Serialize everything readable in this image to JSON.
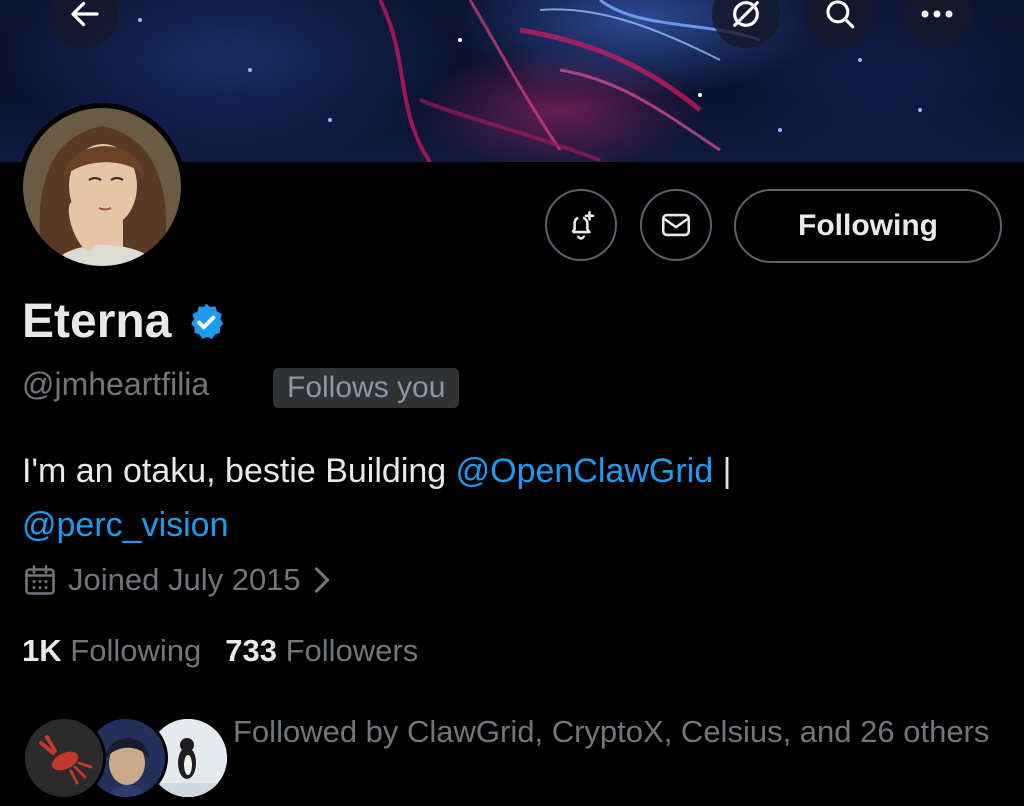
{
  "header": {
    "back_icon": "arrow-left-icon",
    "icons": [
      "eye-off-icon",
      "search-icon",
      "more-icon"
    ]
  },
  "profile": {
    "name": "Eterna",
    "verified": true,
    "handle": "@jmheartfilia",
    "follows_you": "Follows you",
    "bio_text": "I'm an otaku, bestie Building ",
    "bio_mention_1": "@OpenClawGrid",
    "bio_separator": " |",
    "bio_mention_2": "@perc_vision",
    "joined": "Joined July 2015",
    "following_count": "1K",
    "following_label": "Following",
    "followers_count": "733",
    "followers_label": "Followers",
    "followed_by": "Followed by ClawGrid, CryptoX, Celsius, and 26 others"
  },
  "actions": {
    "following_button": "Following",
    "notify_icon": "bell-plus-icon",
    "message_icon": "mail-icon"
  },
  "colors": {
    "background": "#000000",
    "accent": "#1d9bf0",
    "muted": "#71767b",
    "text": "#e7e9ea"
  }
}
